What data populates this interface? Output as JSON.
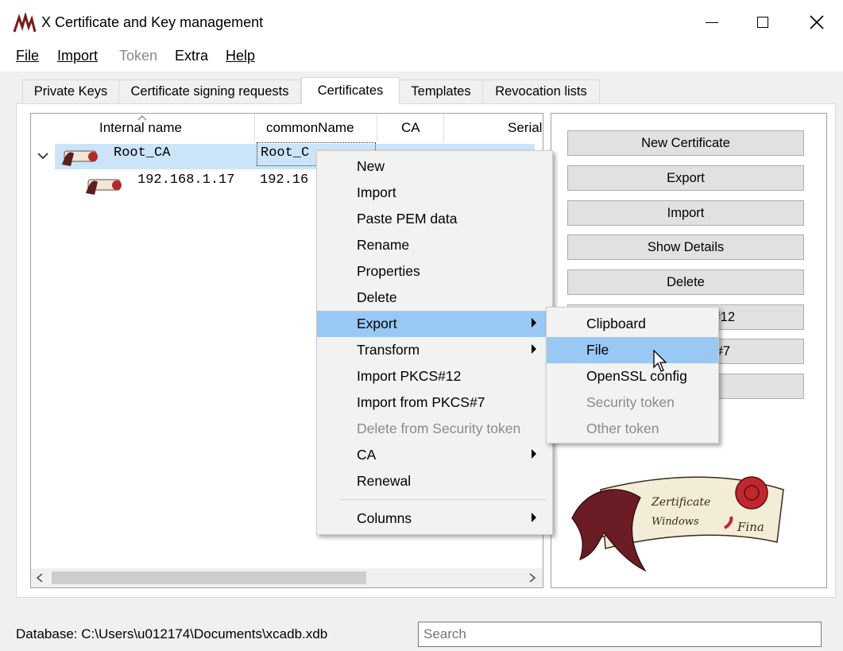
{
  "window": {
    "title": "X Certificate and Key management"
  },
  "menu": [
    {
      "label": "File",
      "disabled": false
    },
    {
      "label": "Import",
      "disabled": false
    },
    {
      "label": "Token",
      "disabled": true
    },
    {
      "label": "Extra",
      "disabled": false
    },
    {
      "label": "Help",
      "disabled": false
    }
  ],
  "tabs": [
    "Private Keys",
    "Certificate signing requests",
    "Certificates",
    "Templates",
    "Revocation lists"
  ],
  "active_tab": "Certificates",
  "table": {
    "columns": [
      "Internal name",
      "commonName",
      "CA",
      "Serial"
    ],
    "rows": [
      {
        "internal_name": "Root_CA",
        "common_name": "Root_C",
        "expanded": true
      },
      {
        "internal_name": "192.168.1.17",
        "common_name": "192.16"
      }
    ]
  },
  "buttons": [
    "New Certificate",
    "Export",
    "Import",
    "Show Details",
    "Delete",
    "#12",
    "#7"
  ],
  "context_menu": {
    "items": [
      {
        "label": "New"
      },
      {
        "label": "Import"
      },
      {
        "label": "Paste PEM data"
      },
      {
        "label": "Rename"
      },
      {
        "label": "Properties"
      },
      {
        "label": "Delete"
      },
      {
        "label": "Export",
        "submenu": true,
        "highlighted": true
      },
      {
        "label": "Transform",
        "submenu": true
      },
      {
        "label": "Import PKCS#12"
      },
      {
        "label": "Import from PKCS#7"
      },
      {
        "label": "Delete from Security token",
        "disabled": true
      },
      {
        "label": "CA",
        "submenu": true
      },
      {
        "label": "Renewal"
      },
      {
        "label": "Columns",
        "submenu": true
      }
    ]
  },
  "export_submenu": {
    "items": [
      {
        "label": "Clipboard"
      },
      {
        "label": "File",
        "highlighted": true
      },
      {
        "label": "OpenSSL config"
      },
      {
        "label": "Security token",
        "disabled": true
      },
      {
        "label": "Other token",
        "disabled": true
      }
    ]
  },
  "status": {
    "database": "Database: C:\\Users\\u012174\\Documents\\xcadb.xdb"
  },
  "search": {
    "placeholder": "Search"
  },
  "logo": {
    "text_line1": "Zertificate",
    "text_line2": "Windows",
    "text_line3": "Fina"
  },
  "colors": {
    "selection": "#cce4f7",
    "menu_highlight": "#99c8f5",
    "seal_red": "#c0282d"
  }
}
